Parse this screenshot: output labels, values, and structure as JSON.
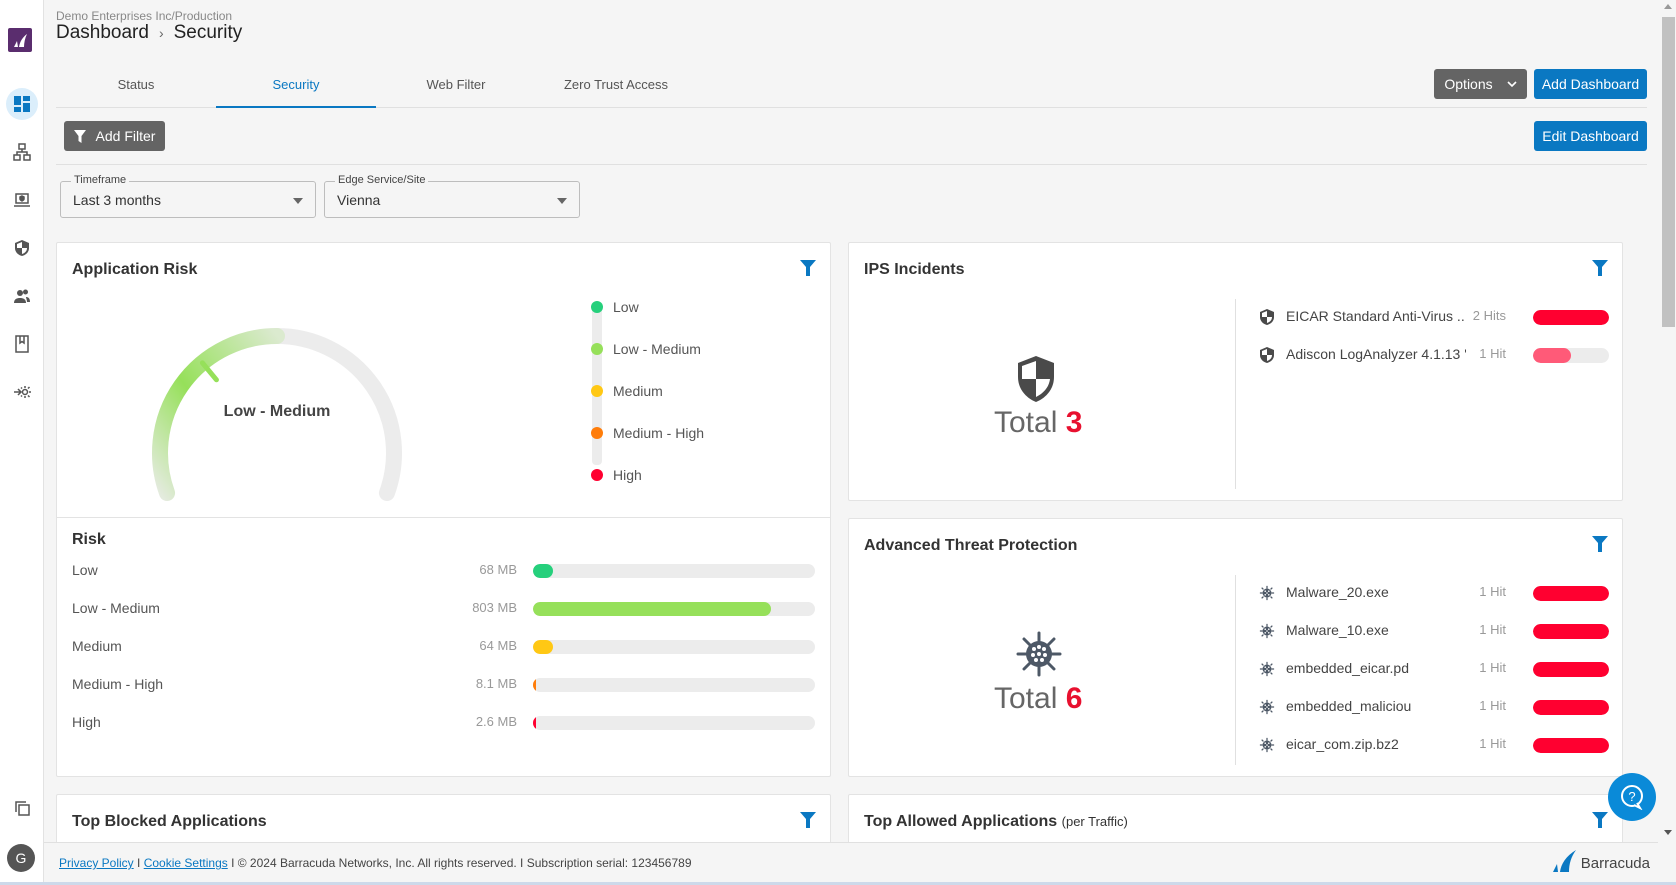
{
  "sidebar": {
    "logo": "barracuda-logo",
    "items": [
      {
        "name": "dashboard",
        "icon": "dashboard-icon",
        "active": true
      },
      {
        "name": "network",
        "icon": "network-icon"
      },
      {
        "name": "devices",
        "icon": "laptop-shield-icon"
      },
      {
        "name": "security",
        "icon": "shield-icon"
      },
      {
        "name": "users",
        "icon": "users-icon"
      },
      {
        "name": "logs",
        "icon": "book-icon"
      },
      {
        "name": "integration",
        "icon": "integration-gear-icon"
      }
    ],
    "bottom_icon": "copy-icon",
    "avatar_initial": "G"
  },
  "header": {
    "org": "Demo Enterprises Inc/Production",
    "breadcrumb": [
      "Dashboard",
      "Security"
    ],
    "separator": "›"
  },
  "tabs": [
    {
      "label": "Status",
      "active": false
    },
    {
      "label": "Security",
      "active": true
    },
    {
      "label": "Web Filter",
      "active": false
    },
    {
      "label": "Zero Trust Access",
      "active": false
    }
  ],
  "toolbar": {
    "options_label": "Options",
    "add_dashboard_label": "Add Dashboard",
    "add_filter_label": "Add Filter",
    "edit_dashboard_label": "Edit Dashboard"
  },
  "filters": {
    "timeframe": {
      "label": "Timeframe",
      "value": "Last 3 months"
    },
    "edge": {
      "label": "Edge Service/Site",
      "value": "Vienna"
    }
  },
  "app_risk": {
    "title": "Application Risk",
    "gauge_value": "Low - Medium",
    "gauge_level": 2,
    "gauge_levels_total": 5,
    "legend": [
      {
        "label": "Low",
        "color": "#26d07c"
      },
      {
        "label": "Low - Medium",
        "color": "#96e05a"
      },
      {
        "label": "Medium",
        "color": "#ffc814"
      },
      {
        "label": "Medium - High",
        "color": "#ff7d0a"
      },
      {
        "label": "High",
        "color": "#ff0030"
      }
    ]
  },
  "risk": {
    "title": "Risk",
    "max_mb": 950,
    "rows": [
      {
        "label": "Low",
        "size": "68 MB",
        "mb": 68,
        "color": "#26d07c"
      },
      {
        "label": "Low - Medium",
        "size": "803 MB",
        "mb": 803,
        "color": "#96e05a"
      },
      {
        "label": "Medium",
        "size": "64 MB",
        "mb": 64,
        "color": "#ffc814"
      },
      {
        "label": "Medium - High",
        "size": "8.1 MB",
        "mb": 8.1,
        "color": "#ff7d0a"
      },
      {
        "label": "High",
        "size": "2.6 MB",
        "mb": 2.6,
        "color": "#ff0030"
      }
    ]
  },
  "ips": {
    "title": "IPS Incidents",
    "total_label": "Total",
    "total": "3",
    "max_hits": 2,
    "items": [
      {
        "name": "EICAR Standard Anti-Virus ...",
        "hits_label": "2 Hits",
        "hits": 2,
        "color": "#ff0030"
      },
      {
        "name": "Adiscon LogAnalyzer 4.1.13 '...",
        "hits_label": "1 Hit",
        "hits": 1,
        "color": "#ff5a78"
      }
    ]
  },
  "atp": {
    "title": "Advanced Threat Protection",
    "total_label": "Total",
    "total": "6",
    "max_hits": 1,
    "items": [
      {
        "name": "Malware_20.exe",
        "hits_label": "1 Hit",
        "hits": 1
      },
      {
        "name": "Malware_10.exe",
        "hits_label": "1 Hit",
        "hits": 1
      },
      {
        "name": "embedded_eicar.pd",
        "hits_label": "1 Hit",
        "hits": 1
      },
      {
        "name": "embedded_maliciou",
        "hits_label": "1 Hit",
        "hits": 1
      },
      {
        "name": "eicar_com.zip.bz2",
        "hits_label": "1 Hit",
        "hits": 1
      }
    ]
  },
  "bottom_cards": {
    "blocked_title": "Top Blocked Applications",
    "allowed_title": "Top Allowed Applications",
    "allowed_sub": "(per Traffic)"
  },
  "footer": {
    "privacy": "Privacy Policy",
    "cookie": "Cookie Settings",
    "copyright": " I © 2024 Barracuda Networks, Inc. All rights reserved. I Subscription serial: 123456789",
    "sep": " I ",
    "brand": "Barracuda"
  },
  "colors": {
    "accent": "#0a78c2",
    "danger": "#e8102f"
  }
}
